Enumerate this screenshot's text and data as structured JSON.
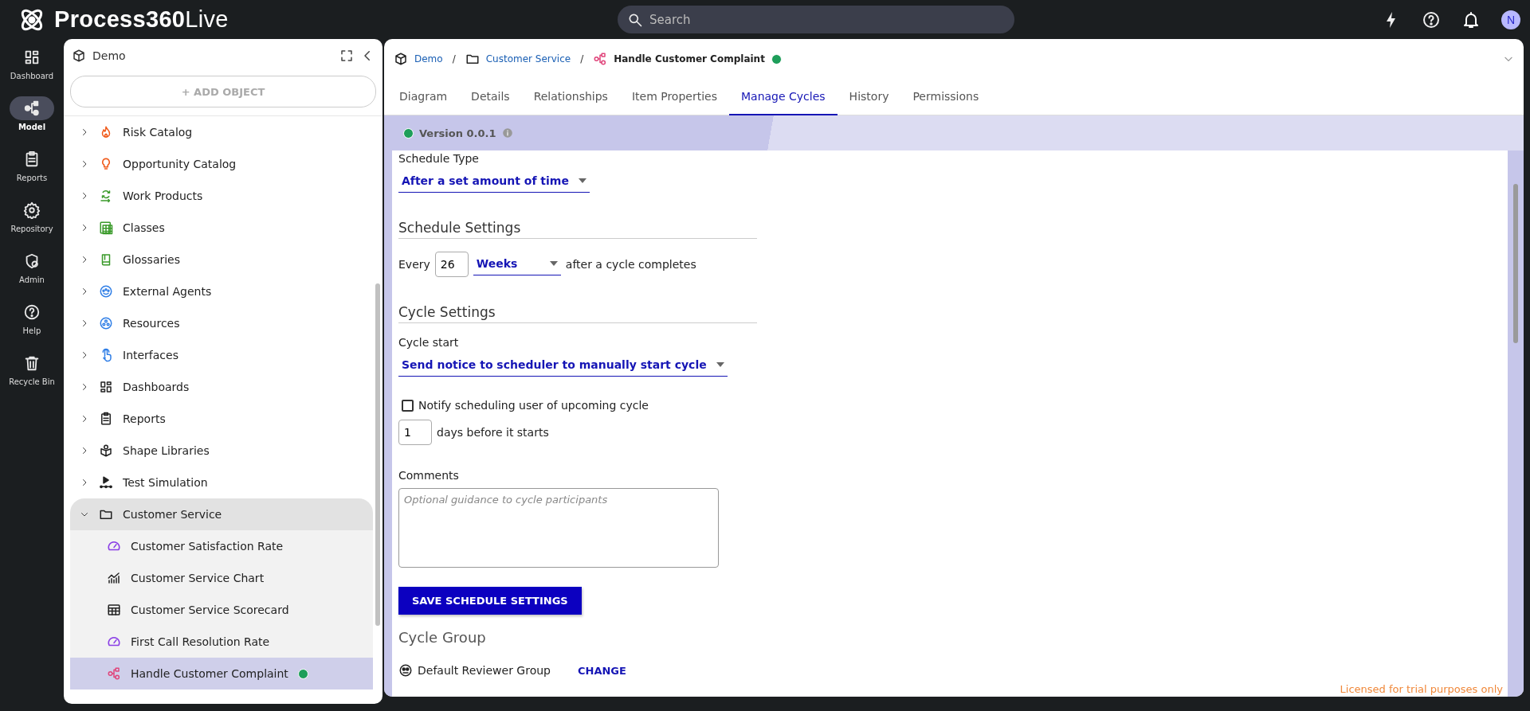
{
  "app": {
    "logo": "**Process360**Live",
    "search": {
      "placeholder": "Search"
    },
    "avatar": "N"
  },
  "nav": [
    {
      "label": "Dashboard",
      "kind": "dashboard",
      "selected": false
    },
    {
      "label": "Model",
      "kind": "model",
      "selected": true
    },
    {
      "label": "Reports",
      "kind": "reports",
      "selected": false
    },
    {
      "label": "Repository",
      "kind": "gear",
      "selected": false
    },
    {
      "label": "Admin",
      "kind": "shield",
      "selected": false
    },
    {
      "label": "Help",
      "kind": "help",
      "selected": false
    },
    {
      "label": "Recycle Bin",
      "kind": "trash",
      "selected": false
    }
  ],
  "tree": {
    "title": "Demo",
    "add_button": "+ ADD OBJECT",
    "items": [
      {
        "label": "Risk Catalog",
        "kind": "risk",
        "expanded": false,
        "selected": false,
        "published": false
      },
      {
        "label": "Opportunity Catalog",
        "kind": "bulb",
        "expanded": false,
        "selected": false,
        "published": false
      },
      {
        "label": "Work Products",
        "kind": "workproducts",
        "expanded": false,
        "selected": false,
        "published": false
      },
      {
        "label": "Classes",
        "kind": "classes",
        "expanded": false,
        "selected": false,
        "published": false
      },
      {
        "label": "Glossaries",
        "kind": "book",
        "expanded": false,
        "selected": false,
        "published": false
      },
      {
        "label": "External Agents",
        "kind": "agents",
        "expanded": false,
        "selected": false,
        "published": false
      },
      {
        "label": "Resources",
        "kind": "resources",
        "expanded": false,
        "selected": false,
        "published": false
      },
      {
        "label": "Interfaces",
        "kind": "pointer",
        "expanded": false,
        "selected": false,
        "published": false
      },
      {
        "label": "Dashboards",
        "kind": "dashboard",
        "expanded": false,
        "selected": false,
        "published": false
      },
      {
        "label": "Reports",
        "kind": "reports",
        "expanded": false,
        "selected": false,
        "published": false
      },
      {
        "label": "Shape Libraries",
        "kind": "shapes",
        "expanded": false,
        "selected": false,
        "published": false
      },
      {
        "label": "Test Simulation",
        "kind": "simulation",
        "expanded": false,
        "selected": false,
        "published": false
      },
      {
        "label": "Customer Service",
        "kind": "folder",
        "expanded": true,
        "selected": false,
        "published": false,
        "children": [
          {
            "label": "Customer Satisfaction Rate",
            "kind": "gauge",
            "selected": false,
            "published": false
          },
          {
            "label": "Customer Service Chart",
            "kind": "chart",
            "selected": false,
            "published": false
          },
          {
            "label": "Customer Service Scorecard",
            "kind": "table",
            "selected": false,
            "published": false
          },
          {
            "label": "First Call Resolution Rate",
            "kind": "gauge",
            "selected": false,
            "published": false
          },
          {
            "label": "Handle Customer Complaint",
            "kind": "process",
            "selected": true,
            "published": true
          }
        ]
      }
    ]
  },
  "breadcrumb": [
    {
      "label": "Demo",
      "kind": "cube",
      "current": false
    },
    {
      "separator": "/",
      "label": "Customer Service",
      "kind": "folder",
      "current": false
    },
    {
      "separator": "/",
      "label": "Handle Customer Complaint",
      "kind": "process",
      "current": true,
      "published": true
    }
  ],
  "tabs": [
    {
      "label": "Diagram",
      "selected": false
    },
    {
      "label": "Details",
      "selected": false
    },
    {
      "label": "Relationships",
      "selected": false
    },
    {
      "label": "Item Properties",
      "selected": false
    },
    {
      "label": "Manage Cycles",
      "selected": true
    },
    {
      "label": "History",
      "selected": false
    },
    {
      "label": "Permissions",
      "selected": false
    }
  ],
  "version": {
    "label": "Version 0.0.1",
    "published": true
  },
  "form": {
    "schedule_type_label": "Schedule Type",
    "schedule_type_value": "After a set amount of time",
    "schedule_settings_heading": "Schedule Settings",
    "every_label": "Every",
    "every_value": "26",
    "unit_value": "Weeks",
    "every_suffix": "after a cycle completes",
    "cycle_settings_heading": "Cycle Settings",
    "cycle_start_label": "Cycle start",
    "cycle_start_value": "Send notice to scheduler to manually start cycle",
    "notify": {
      "label": "Notify scheduling user of upcoming cycle",
      "checked": false
    },
    "days_value": "1",
    "days_suffix": "days before it starts",
    "comments_label": "Comments",
    "comments_placeholder": "Optional guidance to cycle participants",
    "save_button": "SAVE SCHEDULE SETTINGS",
    "cycle_group_heading": "Cycle Group",
    "group_name": "Default Reviewer Group",
    "change_link": "CHANGE"
  },
  "license_note": "Licensed for trial purposes only"
}
